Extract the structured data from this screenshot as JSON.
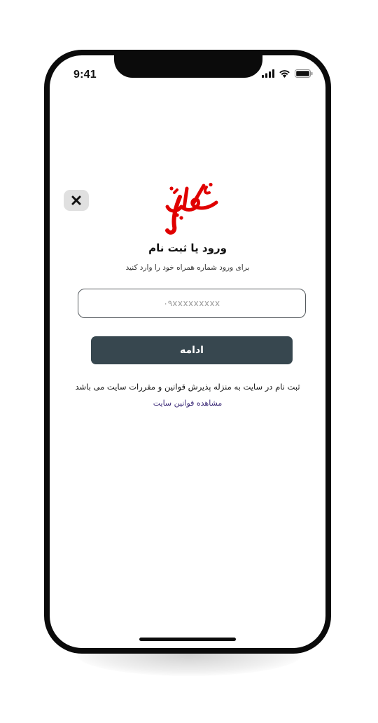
{
  "status_bar": {
    "time": "9:41",
    "icons": [
      "cellular-signal-icon",
      "wifi-icon",
      "battery-icon"
    ]
  },
  "close_button": {
    "icon": "close-icon"
  },
  "logo": {
    "text": "مکان یو",
    "color": "#e00000"
  },
  "login": {
    "title": "ورود یا ثبت نام",
    "subtitle": "برای ورود شماره همراه خود را وارد کنید",
    "phone_placeholder": "۰۹xxxxxxxxx",
    "phone_value": "",
    "continue_label": "ادامه"
  },
  "terms": {
    "text": "ثبت نام در سایت به منزله پذیرش قوانین و مقررات سایت می باشد",
    "link_label": "مشاهده قوانین سایت"
  },
  "colors": {
    "button_bg": "#37474f",
    "link": "#3c2a78",
    "brand_red": "#e00000",
    "frame": "#0b0b0b"
  }
}
